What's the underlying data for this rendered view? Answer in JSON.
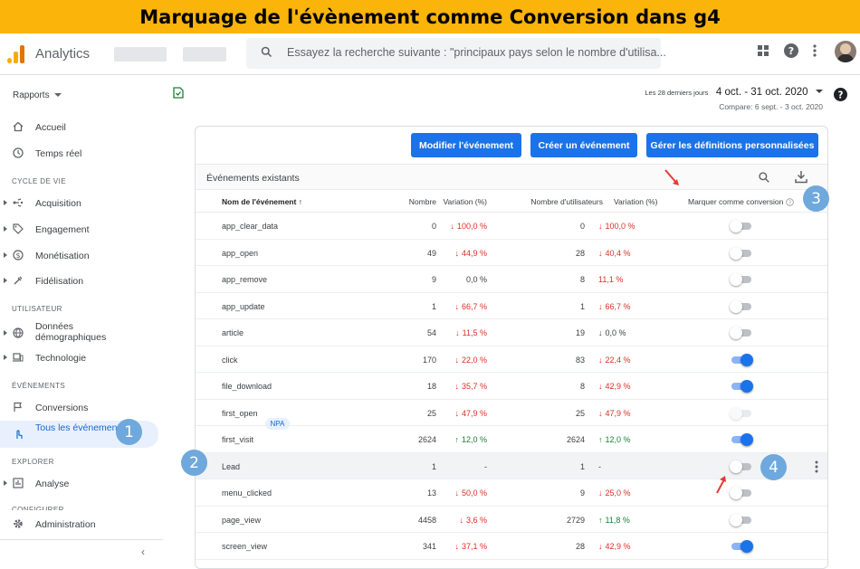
{
  "banner": {
    "title": "Marquage de l'évènement comme Conversion dans g4"
  },
  "topbar": {
    "app_name": "Analytics",
    "search_placeholder": "Essayez la recherche suivante : \"principaux pays selon le nombre d'utilisa..."
  },
  "sidebar": {
    "reports_label": "Rapports",
    "home": "Accueil",
    "realtime": "Temps réel",
    "section_lifecycle": "CYCLE DE VIE",
    "acquisition": "Acquisition",
    "engagement": "Engagement",
    "monetization": "Monétisation",
    "retention": "Fidélisation",
    "section_user": "UTILISATEUR",
    "demographics": "Données démographiques",
    "technology": "Technologie",
    "section_events": "ÉVÉNEMENTS",
    "conversions": "Conversions",
    "all_events": "Tous les événements",
    "section_explore": "EXPLORER",
    "analysis": "Analyse",
    "section_configure": "CONFIGURER",
    "admin": "Administration"
  },
  "daterange": {
    "prefix": "Les 28 derniers jours",
    "range": "4 oct. - 31 oct. 2020",
    "compare": "Compare: 6 sept. - 3 oct. 2020"
  },
  "buttons": {
    "modify": "Modifier l'événement",
    "create": "Créer un événement",
    "manage": "Gérer les définitions personnalisées"
  },
  "table": {
    "section_title": "Événements existants",
    "headers": {
      "name": "Nom de l'événement",
      "count": "Nombre",
      "variation": "Variation (%)",
      "users": "Nombre d'utilisateurs",
      "users_variation": "Variation (%)",
      "conversion": "Marquer comme conversion"
    },
    "rows": [
      {
        "name": "app_clear_data",
        "count": "0",
        "var": "100,0 %",
        "var_dir": "down",
        "users": "0",
        "uvar": "100,0 %",
        "uvar_dir": "down",
        "conversion": "off"
      },
      {
        "name": "app_open",
        "count": "49",
        "var": "44,9 %",
        "var_dir": "down",
        "users": "28",
        "uvar": "40,4 %",
        "uvar_dir": "down",
        "conversion": "off"
      },
      {
        "name": "app_remove",
        "count": "9",
        "var": "0,0 %",
        "var_dir": "none",
        "users": "8",
        "uvar": "11,1 %",
        "uvar_dir": "down-noarrow",
        "conversion": "off"
      },
      {
        "name": "app_update",
        "count": "1",
        "var": "66,7 %",
        "var_dir": "down",
        "users": "1",
        "uvar": "66,7 %",
        "uvar_dir": "down",
        "conversion": "off"
      },
      {
        "name": "article",
        "count": "54",
        "var": "11,5 %",
        "var_dir": "down",
        "users": "19",
        "uvar": "0,0 %",
        "uvar_dir": "flat",
        "conversion": "off"
      },
      {
        "name": "click",
        "count": "170",
        "var": "22,0 %",
        "var_dir": "down",
        "users": "83",
        "uvar": "22,4 %",
        "uvar_dir": "down",
        "conversion": "on"
      },
      {
        "name": "file_download",
        "count": "18",
        "var": "35,7 %",
        "var_dir": "down",
        "users": "8",
        "uvar": "42,9 %",
        "uvar_dir": "down",
        "conversion": "on"
      },
      {
        "name": "first_open",
        "badge": "NPA",
        "count": "25",
        "var": "47,9 %",
        "var_dir": "down",
        "users": "25",
        "uvar": "47,9 %",
        "uvar_dir": "down",
        "conversion": "disabled"
      },
      {
        "name": "first_visit",
        "count": "2624",
        "var": "12,0 %",
        "var_dir": "up",
        "users": "2624",
        "uvar": "12,0 %",
        "uvar_dir": "up",
        "conversion": "on"
      },
      {
        "name": "Lead",
        "count": "1",
        "var": "-",
        "var_dir": "none",
        "users": "1",
        "uvar": "-",
        "uvar_dir": "none",
        "conversion": "off"
      },
      {
        "name": "menu_clicked",
        "count": "13",
        "var": "50,0 %",
        "var_dir": "down",
        "users": "9",
        "uvar": "25,0 %",
        "uvar_dir": "down",
        "conversion": "off"
      },
      {
        "name": "page_view",
        "count": "4458",
        "var": "3,6 %",
        "var_dir": "down",
        "users": "2729",
        "uvar": "11,8 %",
        "uvar_dir": "up",
        "conversion": "off"
      },
      {
        "name": "screen_view",
        "count": "341",
        "var": "37,1 %",
        "var_dir": "down",
        "users": "28",
        "uvar": "42,9 %",
        "uvar_dir": "down",
        "conversion": "on"
      }
    ]
  },
  "annotations": {
    "b1": "1",
    "b2": "2",
    "b3": "3",
    "b4": "4"
  },
  "colors": {
    "accent": "#1a73e8",
    "banner": "#fbb40a",
    "badge": "#6fa8dc",
    "down": "#d93025",
    "up": "#188038"
  }
}
